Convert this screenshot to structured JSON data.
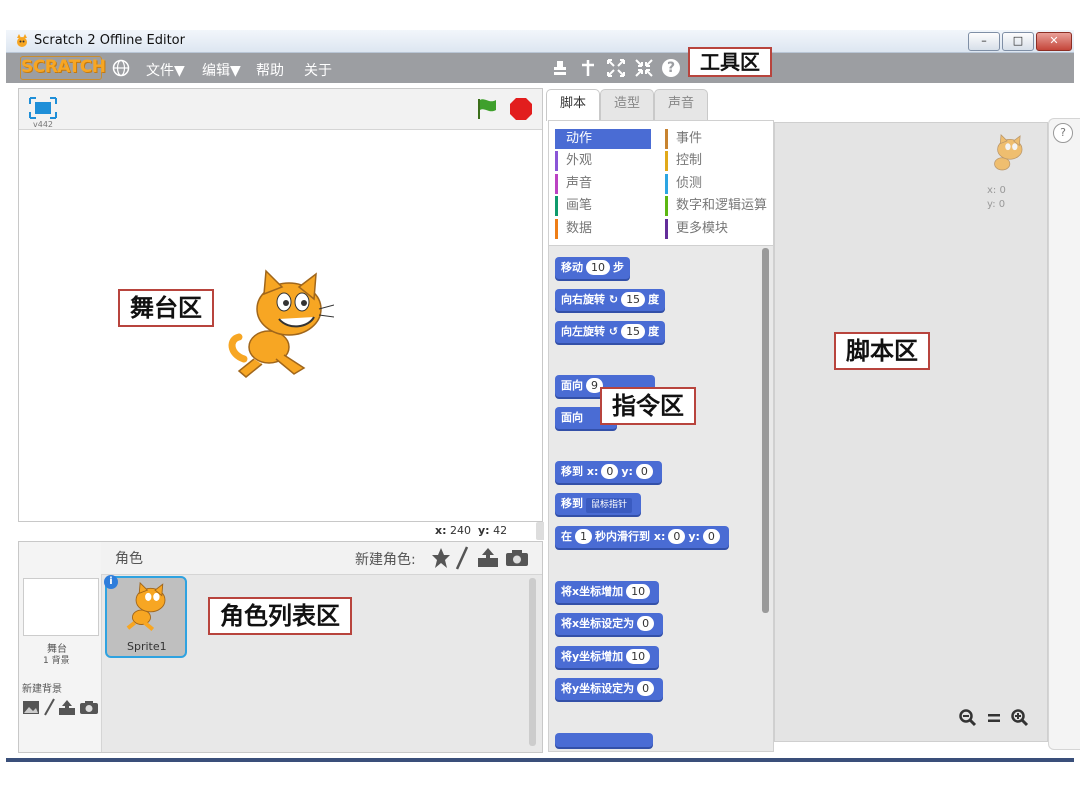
{
  "window": {
    "title": "Scratch 2 Offline Editor",
    "minimize": "–",
    "maximize": "□",
    "close": "✕"
  },
  "menubar": {
    "logo": "SCRATCH",
    "items": [
      "文件▼",
      "编辑▼",
      "帮助",
      "关于"
    ],
    "help_symbol": "?"
  },
  "stage": {
    "version": "v442",
    "mouse_x_label": "x:",
    "mouse_x": "240",
    "mouse_y_label": "y:",
    "mouse_y": "42"
  },
  "tabs": [
    "脚本",
    "造型",
    "声音"
  ],
  "categories": [
    {
      "label": "动作",
      "color": "#4a6cd4"
    },
    {
      "label": "事件",
      "color": "#c88330"
    },
    {
      "label": "外观",
      "color": "#8a55d7"
    },
    {
      "label": "控制",
      "color": "#e1a91a"
    },
    {
      "label": "声音",
      "color": "#bb42c3"
    },
    {
      "label": "侦测",
      "color": "#2ca5e2"
    },
    {
      "label": "画笔",
      "color": "#0e9a6c"
    },
    {
      "label": "数字和逻辑运算",
      "color": "#5cb712"
    },
    {
      "label": "数据",
      "color": "#ee7d16"
    },
    {
      "label": "更多模块",
      "color": "#632d99"
    }
  ],
  "blocks": {
    "move": {
      "a": "移动",
      "v": "10",
      "b": "步"
    },
    "turn_right": {
      "a": "向右旋转",
      "sym": "↻",
      "v": "15",
      "b": "度"
    },
    "turn_left": {
      "a": "向左旋转",
      "sym": "↺",
      "v": "15",
      "b": "度"
    },
    "point_dir": {
      "a": "面向",
      "v": "9"
    },
    "point_towards": {
      "a": "面向"
    },
    "goto_xy": {
      "a": "移到",
      "xl": "x:",
      "xv": "0",
      "yl": "y:",
      "yv": "0"
    },
    "goto": {
      "a": "移到",
      "v": "鼠标指针"
    },
    "glide": {
      "a": "在",
      "v": "1",
      "b": "秒内滑行到",
      "xl": "x:",
      "xv": "0",
      "yl": "y:",
      "yv": "0"
    },
    "change_x": {
      "a": "将x坐标增加",
      "v": "10"
    },
    "set_x": {
      "a": "将x坐标设定为",
      "v": "0"
    },
    "change_y": {
      "a": "将y坐标增加",
      "v": "10"
    },
    "set_y": {
      "a": "将y坐标设定为",
      "v": "0"
    }
  },
  "sprites": {
    "header": "角色",
    "new_sprite": "新建角色:",
    "stage_label": "舞台",
    "stage_backdrops": "1 背景",
    "new_backdrop": "新建背景",
    "sprite_name": "Sprite1",
    "info_badge": "i"
  },
  "script_area": {
    "x_label": "x:",
    "x": "0",
    "y_label": "y:",
    "y": "0",
    "help": "?"
  },
  "annotations": {
    "toolbar": "工具区",
    "stage": "舞台区",
    "palette": "指令区",
    "scripts": "脚本区",
    "sprite_list": "角色列表区"
  }
}
